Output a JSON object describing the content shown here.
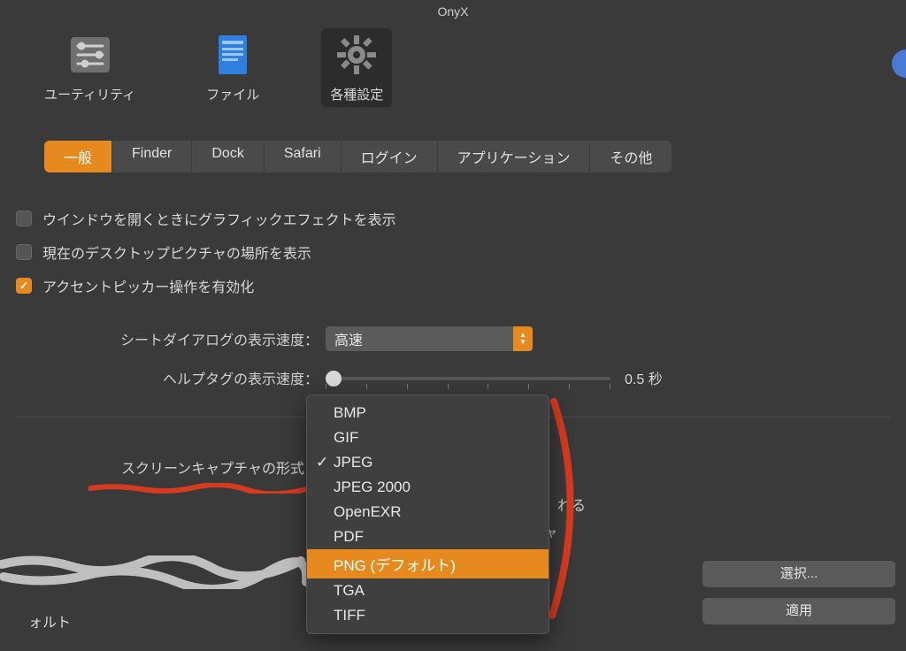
{
  "window": {
    "title": "OnyX"
  },
  "toolbar": {
    "items": [
      {
        "label": "ユーティリティ"
      },
      {
        "label": "ファイル"
      },
      {
        "label": "各種設定"
      }
    ]
  },
  "tabs": [
    "一般",
    "Finder",
    "Dock",
    "Safari",
    "ログイン",
    "アプリケーション",
    "その他"
  ],
  "checks": {
    "c1": "ウインドウを開くときにグラフィックエフェクトを表示",
    "c2": "現在のデスクトップピクチャの場所を表示",
    "c3": "アクセントピッカー操作を有効化"
  },
  "rows": {
    "sheet_speed_label": "シートダイアログの表示速度：",
    "sheet_speed_value": "高速",
    "help_speed_label": "ヘルプタグの表示速度：",
    "help_speed_value": "0.5 秒",
    "capture_format_label": "スクリーンキャプチャの形式："
  },
  "peek": {
    "p1": "れる",
    "p2": "ォルト"
  },
  "dropdown": {
    "items": [
      "BMP",
      "GIF",
      "JPEG",
      "JPEG 2000",
      "OpenEXR",
      "PDF",
      "PNG (デフォルト)",
      "TGA",
      "TIFF"
    ],
    "selected_index": 2,
    "highlight_index": 6
  },
  "buttons": {
    "choose": "選択...",
    "apply": "適用"
  }
}
